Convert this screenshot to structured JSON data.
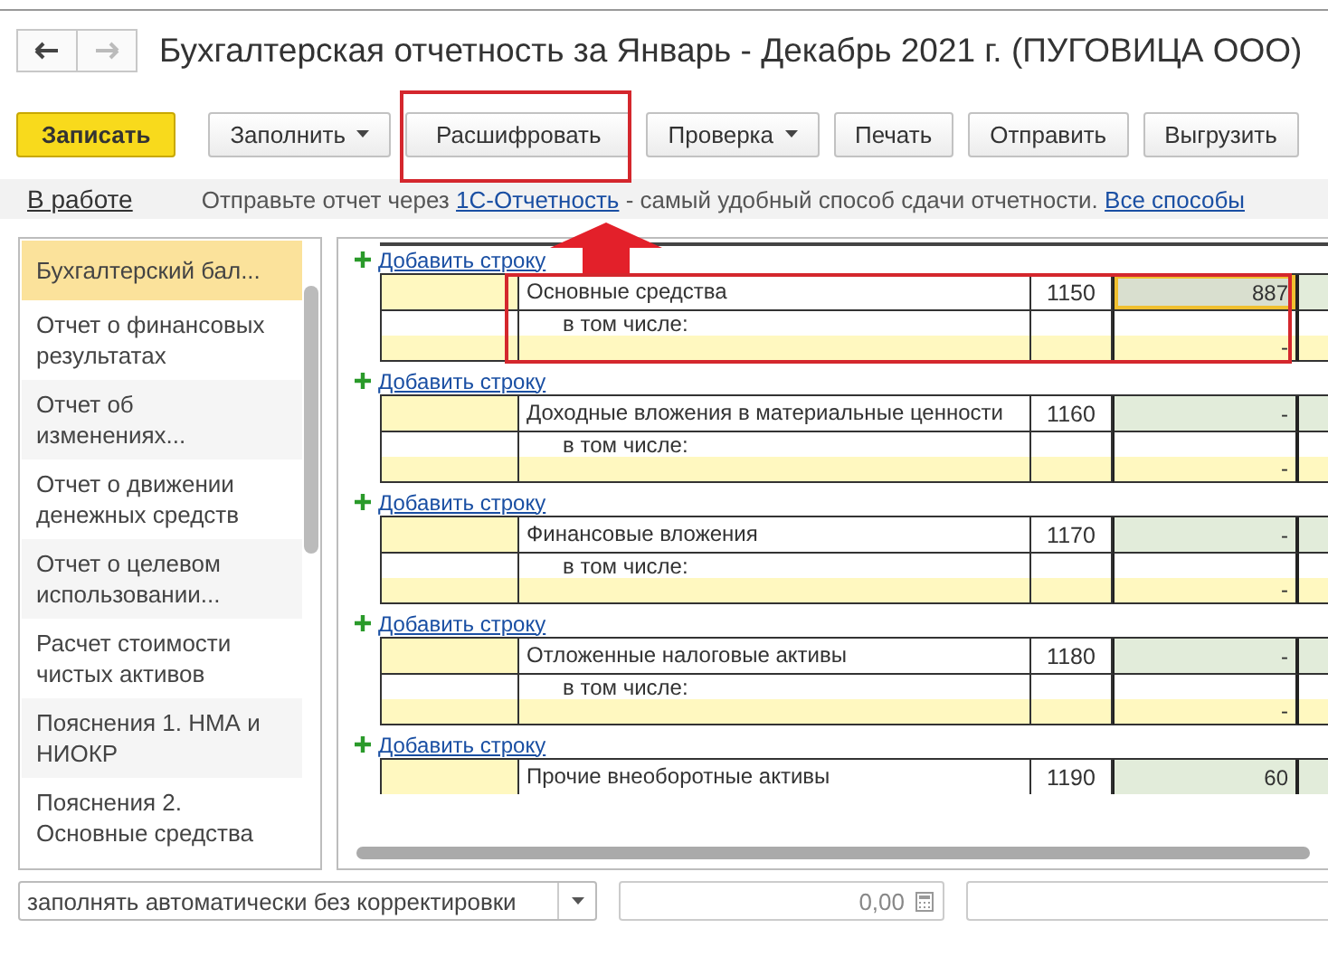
{
  "window": {
    "title": "Бухгалтерская отчетность за Январь - Декабрь 2021 г. (ПУГОВИЦА ООО)"
  },
  "toolbar": [
    {
      "label": "Записать",
      "kind": "primary"
    },
    {
      "label": "Заполнить",
      "kind": "dropdown"
    },
    {
      "label": "Расшифровать",
      "kind": "plain"
    },
    {
      "label": "Проверка",
      "kind": "dropdown"
    },
    {
      "label": "Печать",
      "kind": "plain"
    },
    {
      "label": "Отправить",
      "kind": "plain"
    },
    {
      "label": "Выгрузить",
      "kind": "plain"
    }
  ],
  "info_bar": {
    "status": "В работе",
    "text_before": "Отправьте отчет через",
    "link": "1С-Отчетность",
    "text_after": "- самый удобный способ сдачи отчетности.",
    "all_link": "Все способы"
  },
  "sidebar": {
    "items": [
      {
        "label": "Бухгалтерский бал...",
        "selected": true
      },
      {
        "label": "Отчет о финансовых результатах",
        "selected": false
      },
      {
        "label": "Отчет об изменениях...",
        "selected": false
      },
      {
        "label": "Отчет о движении денежных средств",
        "selected": false
      },
      {
        "label": "Отчет о целевом использовании...",
        "selected": false
      },
      {
        "label": "Расчет стоимости чистых активов",
        "selected": false
      },
      {
        "label": "Пояснения 1. НМА и НИОКР",
        "selected": false
      },
      {
        "label": "Пояснения 2. Основные средства",
        "selected": false
      }
    ]
  },
  "sections": [
    {
      "add_link": "Добавить строку",
      "name": "Основные средства",
      "code": "1150",
      "value": "887",
      "selected": true,
      "subrow": {
        "label": "в том числе:",
        "value": "-"
      }
    },
    {
      "add_link": "Добавить строку",
      "name": "Доходные вложения в материальные ценности",
      "code": "1160",
      "value": "-",
      "selected": false,
      "subrow": {
        "label": "в том числе:",
        "value": "-"
      }
    },
    {
      "add_link": "Добавить строку",
      "name": "Финансовые вложения",
      "code": "1170",
      "value": "-",
      "selected": false,
      "subrow": {
        "label": "в том числе:",
        "value": "-"
      }
    },
    {
      "add_link": "Добавить строку",
      "name": "Отложенные налоговые активы",
      "code": "1180",
      "value": "-",
      "selected": false,
      "subrow": {
        "label": "в том числе:",
        "value": "-"
      }
    },
    {
      "add_link": "Добавить строку",
      "name": "Прочие внеоборотные активы",
      "code": "1190",
      "value": "60",
      "selected": false
    }
  ],
  "footer": {
    "fill_mode": "заполнять автоматически без корректировки",
    "amount": "0,00"
  }
}
